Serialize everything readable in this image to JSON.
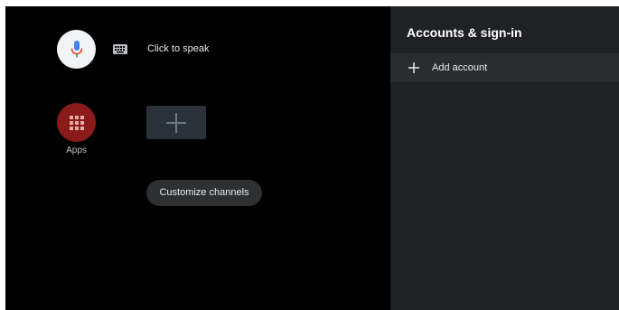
{
  "home": {
    "voice": {
      "label": "Click to speak",
      "icon": "microphone-icon",
      "keyboard_icon": "keyboard-icon"
    },
    "apps": {
      "label": "Apps",
      "icon": "apps-grid-icon",
      "color": "#8b1a1a"
    },
    "add_tile_icon": "plus-icon",
    "customize_channels_label": "Customize channels"
  },
  "panel": {
    "title": "Accounts & sign-in",
    "items": [
      {
        "label": "Add account",
        "icon": "plus-icon"
      }
    ]
  },
  "colors": {
    "screen_bg": "#000000",
    "panel_bg": "#202124",
    "panel_row_bg": "#2b2c2f",
    "tile_bg": "#2a3138",
    "mic_blue": "#4285f4",
    "mic_red": "#ea4335"
  }
}
